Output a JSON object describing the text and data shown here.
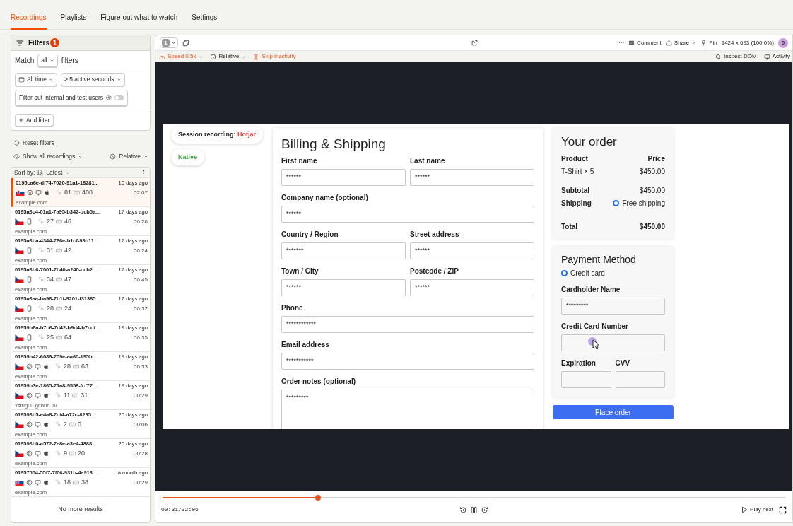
{
  "nav_tabs": [
    {
      "label": "Recordings",
      "selected": true
    },
    {
      "label": "Playlists",
      "selected": false
    },
    {
      "label": "Figure out what to watch",
      "selected": false
    },
    {
      "label": "Settings",
      "selected": false
    }
  ],
  "filters": {
    "title": "Filters",
    "count": "1",
    "match_label": "Match",
    "match_value": "all",
    "match_suffix": "filters",
    "chips": [
      {
        "kind": "date",
        "label": "All time"
      },
      {
        "kind": "duration",
        "label": "> 5 active seconds"
      }
    ],
    "internal_filter": {
      "label": "Filter out internal and test users",
      "on": false
    },
    "add_filter": "Add filter"
  },
  "reset_filters": "Reset filters",
  "show_recordings": "Show all recordings",
  "time_mode": "Relative",
  "sort": {
    "label": "Sort by:",
    "value": "Latest"
  },
  "recordings": [
    {
      "id": "0195ca6e-df74-7020-91a1-18281...",
      "ago": "10 days ago",
      "flag": {
        "kind": "sk"
      },
      "device": {
        "kind": "desktop"
      },
      "clicks": "81",
      "keys": "408",
      "duration": "02:07",
      "url": "example.com",
      "selected": true
    },
    {
      "id": "0195a6c4-01a1-7a95-b342-bcb5a...",
      "ago": "17 days ago",
      "flag": {
        "kind": "cz"
      },
      "device": {
        "kind": "mobile"
      },
      "clicks": "27",
      "keys": "46",
      "duration": "00:26",
      "url": "example.com",
      "selected": false
    },
    {
      "id": "0195a6ba-4344-766e-b1cf-99b11...",
      "ago": "17 days ago",
      "flag": {
        "kind": "cz"
      },
      "device": {
        "kind": "mobile"
      },
      "clicks": "31",
      "keys": "42",
      "duration": "00:24",
      "url": "example.com",
      "selected": false
    },
    {
      "id": "0195a6b6-7001-7b40-a240-ccb2...",
      "ago": "17 days ago",
      "flag": {
        "kind": "cz"
      },
      "device": {
        "kind": "mobile"
      },
      "clicks": "34",
      "keys": "47",
      "duration": "00:45",
      "url": "example.com",
      "selected": false
    },
    {
      "id": "0195a6aa-ba96-7b1f-9201-f31385...",
      "ago": "17 days ago",
      "flag": {
        "kind": "cz"
      },
      "device": {
        "kind": "mobile"
      },
      "clicks": "28",
      "keys": "24",
      "duration": "00:32",
      "url": "example.com",
      "selected": false
    },
    {
      "id": "01959b8a-b7c6-7d42-b9d4-b7cdf...",
      "ago": "19 days ago",
      "flag": {
        "kind": "cz"
      },
      "device": {
        "kind": "mobile"
      },
      "clicks": "25",
      "keys": "64",
      "duration": "00:35",
      "url": "example.com",
      "selected": false
    },
    {
      "id": "01959b42-6089-759e-aa60-195b...",
      "ago": "19 days ago",
      "flag": {
        "kind": "cz"
      },
      "device": {
        "kind": "desktop"
      },
      "clicks": "28",
      "keys": "63",
      "duration": "00:33",
      "url": "example.com",
      "selected": false
    },
    {
      "id": "01959b3e-1865-71a8-9558-fcf77...",
      "ago": "19 days ago",
      "flag": {
        "kind": "cz"
      },
      "device": {
        "kind": "desktop"
      },
      "clicks": "11",
      "keys": "31",
      "duration": "00:29",
      "url": "xstrig00.github.io/",
      "selected": false
    },
    {
      "id": "019596b5-e4a8-7df4-a72c-8295...",
      "ago": "20 days ago",
      "flag": {
        "kind": "cz"
      },
      "device": {
        "kind": "desktop"
      },
      "clicks": "2",
      "keys": "0",
      "duration": "00:06",
      "url": "example.com",
      "selected": false
    },
    {
      "id": "019596b0-a572-7e8e-a3e4-4888...",
      "ago": "20 days ago",
      "flag": {
        "kind": "cz"
      },
      "device": {
        "kind": "desktop"
      },
      "clicks": "9",
      "keys": "20",
      "duration": "00:28",
      "url": "example.com",
      "selected": false
    },
    {
      "id": "01957554-55f7-7f06-931b-4a913...",
      "ago": "a month ago",
      "flag": {
        "kind": "sk"
      },
      "device": {
        "kind": "desktop"
      },
      "clicks": "18",
      "keys": "38",
      "duration": "00:29",
      "url": "example.com",
      "selected": false
    }
  ],
  "end_message": "No more results",
  "player": {
    "window_count": "1",
    "toolbar": {
      "more": "···",
      "comment": "Comment",
      "share": "Share",
      "pin": "Pin",
      "resolution": "1424 x 693 (100.0%)",
      "avatar": "0"
    },
    "controls": {
      "speed": "Speed 0.5x",
      "time_mode": "Relative",
      "skip_inactivity": "Skip inactivity",
      "inspect": "Inspect DOM",
      "activity": "Activity"
    },
    "page": {
      "session_label": "Session recording:",
      "session_tool": "Hotjar",
      "mode_tag": "Native",
      "billing": {
        "title": "Billing & Shipping",
        "rows": [
          [
            {
              "label": "First name",
              "value": "******"
            },
            {
              "label": "Last name",
              "value": "******"
            }
          ],
          [
            {
              "label": "Company name (optional)",
              "value": "******"
            }
          ],
          [
            {
              "label": "Country / Region",
              "value": "*******"
            },
            {
              "label": "Street address",
              "value": "******"
            }
          ],
          [
            {
              "label": "Town / City",
              "value": "******"
            },
            {
              "label": "Postcode / ZIP",
              "value": "******"
            }
          ],
          [
            {
              "label": "Phone",
              "value": "************"
            }
          ],
          [
            {
              "label": "Email address",
              "value": "***********"
            }
          ],
          [
            {
              "label": "Order notes (optional)",
              "value": "*********",
              "kind": "textarea"
            }
          ]
        ]
      },
      "order": {
        "title": "Your order",
        "product_header": "Product",
        "price_header": "Price",
        "items": [
          {
            "name": "T-Shirt × 5",
            "price": "$450.00"
          }
        ],
        "subtotal_label": "Subtotal",
        "subtotal": "$450.00",
        "shipping_label": "Shipping",
        "shipping_options": [
          {
            "label": "Free shipping",
            "selected": true
          }
        ],
        "total_label": "Total",
        "total": "$450.00"
      },
      "payment": {
        "title": "Payment Method",
        "methods": [
          {
            "label": "Credit card",
            "selected": true
          }
        ],
        "rows": [
          [
            {
              "label": "Cardholder Name",
              "value": "*********"
            }
          ],
          [
            {
              "label": "Credit Card Number",
              "cursor": true
            }
          ],
          [
            {
              "label": "Expiration"
            },
            {
              "label": "CVV"
            }
          ]
        ],
        "button": "Place order"
      }
    },
    "timeline": {
      "level": 0.25,
      "time": "00:31/02:06",
      "next": "Play next"
    }
  }
}
